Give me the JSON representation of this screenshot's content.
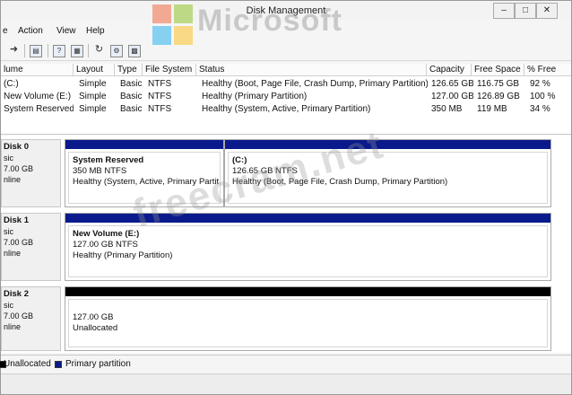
{
  "window": {
    "title": "Disk Management",
    "controls": {
      "minimize": "–",
      "maximize": "□",
      "close": "✕"
    }
  },
  "menu": [
    "e",
    "Action",
    "View",
    "Help"
  ],
  "toolbar": {
    "icons": [
      "arrow-right-icon",
      "console-tree-icon",
      "help-icon",
      "properties-icon",
      "refresh-icon",
      "settings-icon",
      "console-icon"
    ]
  },
  "volume_list": {
    "columns": [
      "lume",
      "Layout",
      "Type",
      "File System",
      "Status",
      "Capacity",
      "Free Space",
      "% Free"
    ],
    "rows": [
      [
        "(C:)",
        "Simple",
        "Basic",
        "NTFS",
        "Healthy (Boot, Page File, Crash Dump, Primary Partition)",
        "126.65 GB",
        "116.75 GB",
        "92 %"
      ],
      [
        "New Volume (E:)",
        "Simple",
        "Basic",
        "NTFS",
        "Healthy (Primary Partition)",
        "127.00 GB",
        "126.89 GB",
        "100 %"
      ],
      [
        "System Reserved",
        "Simple",
        "Basic",
        "NTFS",
        "Healthy (System, Active, Primary Partition)",
        "350 MB",
        "119 MB",
        "34 %"
      ]
    ]
  },
  "disks": [
    {
      "name": "Disk 0",
      "type": "sic",
      "size": "7.00 GB",
      "state": "nline",
      "partitions": [
        {
          "name": "System Reserved",
          "size": "350 MB NTFS",
          "status": "Healthy (System, Active, Primary Partit"
        },
        {
          "name": "(C:)",
          "size": "126.65 GB NTFS",
          "status": "Healthy (Boot, Page File, Crash Dump, Primary Partition)"
        }
      ]
    },
    {
      "name": "Disk 1",
      "type": "sic",
      "size": "7.00 GB",
      "state": "nline",
      "partitions": [
        {
          "name": "New Volume  (E:)",
          "size": "127.00 GB NTFS",
          "status": "Healthy (Primary Partition)"
        }
      ]
    },
    {
      "name": "Disk 2",
      "type": "sic",
      "size": "7.00 GB",
      "state": "nline",
      "partitions": [
        {
          "name": "",
          "size": "127.00 GB",
          "status": "Unallocated"
        }
      ]
    }
  ],
  "legend": [
    {
      "label": "Unallocated",
      "color": "#000000"
    },
    {
      "label": "Primary partition",
      "color": "#0a1a8c"
    }
  ],
  "watermarks": {
    "logo_text": "Microsoft",
    "site_text": "freecram.net"
  },
  "colors": {
    "primary_partition": "#0a1a8c",
    "unallocated": "#000000"
  }
}
